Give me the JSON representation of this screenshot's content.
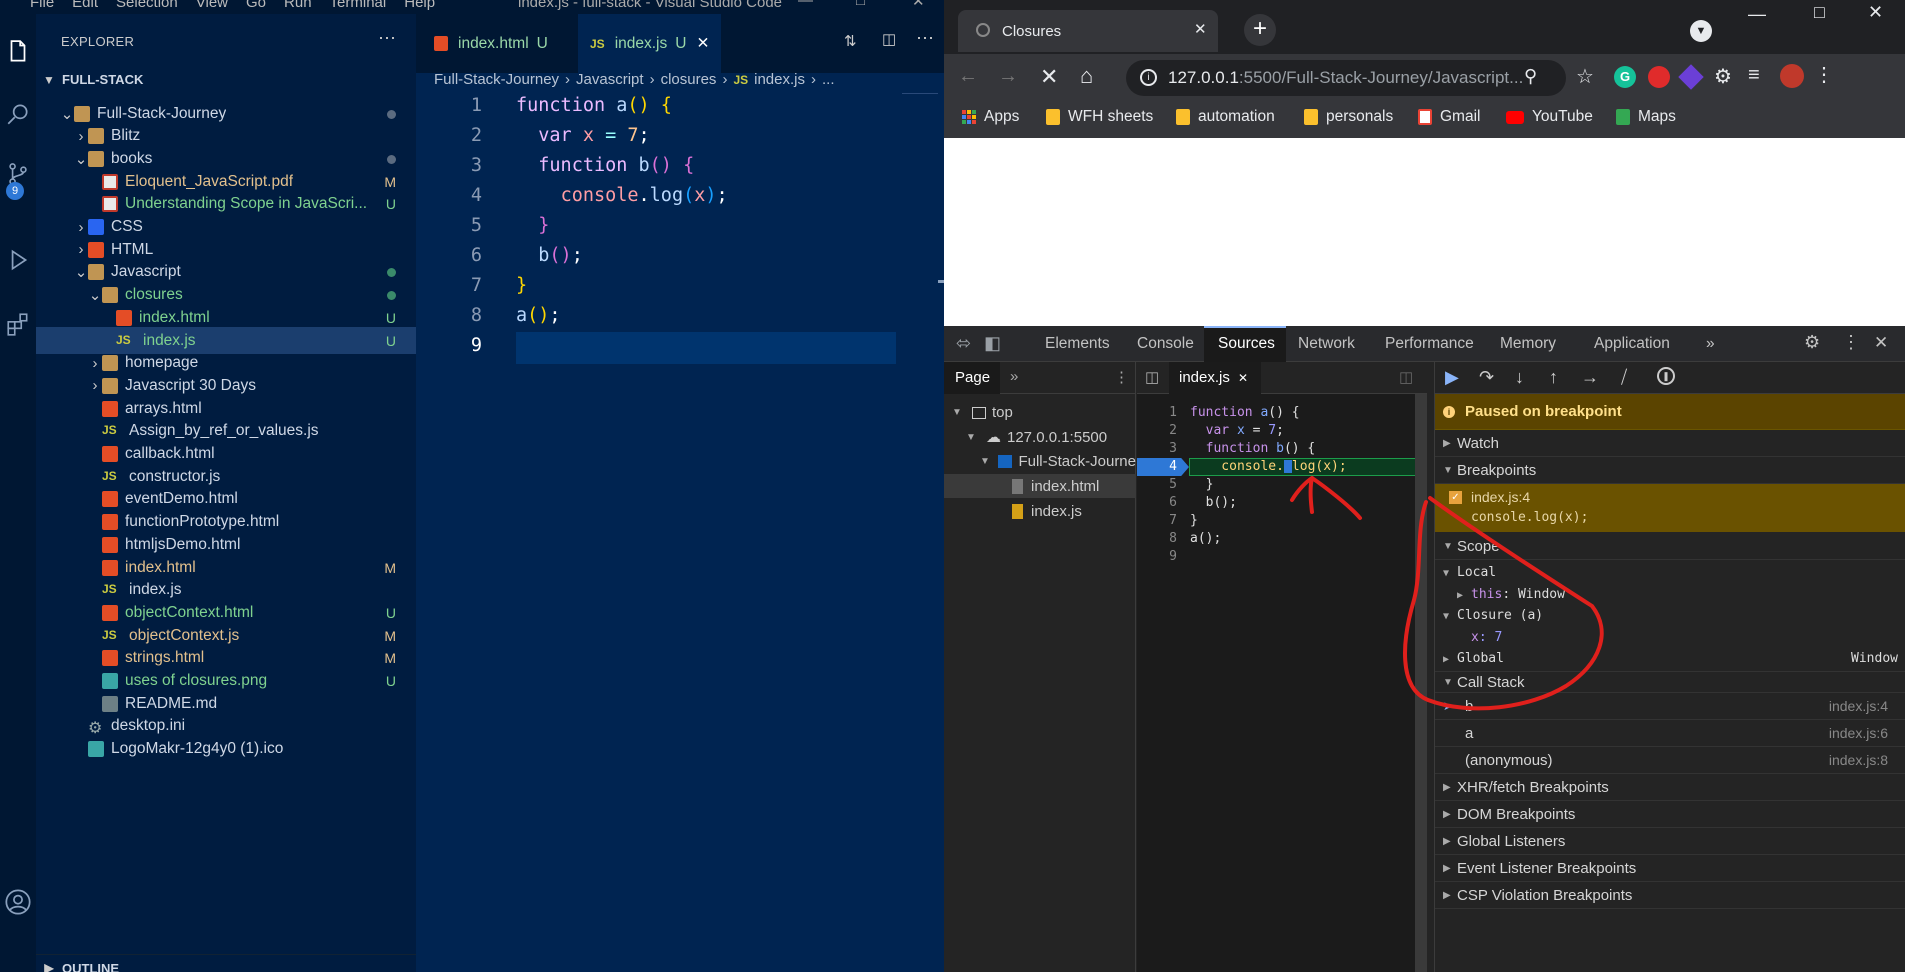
{
  "vscode": {
    "menu": [
      "File",
      "Edit",
      "Selection",
      "View",
      "Go",
      "Run",
      "Terminal",
      "Help"
    ],
    "window_title": "index.js - full-stack - Visual Studio Code",
    "scm_badge": "9",
    "explorer_title": "EXPLORER",
    "workspace": "FULL-STACK",
    "outline": "OUTLINE",
    "tree": [
      {
        "label": "Full-Stack-Journey",
        "type": "folder",
        "open": true,
        "status": "dot"
      },
      {
        "label": "Blitz",
        "type": "folder",
        "open": false,
        "status": ""
      },
      {
        "label": "books",
        "type": "folder",
        "open": true,
        "status": "dot"
      },
      {
        "label": "Eloquent_JavaScript.pdf",
        "type": "pdf",
        "status": "M"
      },
      {
        "label": "Understanding Scope in JavaScri...",
        "type": "pdf",
        "status": "U"
      },
      {
        "label": "CSS",
        "type": "css",
        "open": false,
        "status": ""
      },
      {
        "label": "HTML",
        "type": "html",
        "open": false,
        "status": ""
      },
      {
        "label": "Javascript",
        "type": "folder",
        "open": true,
        "status": "dotg"
      },
      {
        "label": "closures",
        "type": "folder",
        "open": true,
        "status": "dotg"
      },
      {
        "label": "index.html",
        "type": "html",
        "status": "U"
      },
      {
        "label": "index.js",
        "type": "js",
        "status": "U"
      },
      {
        "label": "homepage",
        "type": "folder",
        "open": false,
        "status": ""
      },
      {
        "label": "Javascript 30 Days",
        "type": "folder",
        "open": false,
        "status": ""
      },
      {
        "label": "arrays.html",
        "type": "html",
        "status": ""
      },
      {
        "label": "Assign_by_ref_or_values.js",
        "type": "js",
        "status": ""
      },
      {
        "label": "callback.html",
        "type": "html",
        "status": ""
      },
      {
        "label": "constructor.js",
        "type": "js",
        "status": ""
      },
      {
        "label": "eventDemo.html",
        "type": "html",
        "status": ""
      },
      {
        "label": "functionPrototype.html",
        "type": "html",
        "status": ""
      },
      {
        "label": "htmljsDemo.html",
        "type": "html",
        "status": ""
      },
      {
        "label": "index.html",
        "type": "html",
        "status": "M"
      },
      {
        "label": "index.js",
        "type": "js",
        "status": ""
      },
      {
        "label": "objectContext.html",
        "type": "html",
        "status": "U"
      },
      {
        "label": "objectContext.js",
        "type": "js",
        "status": "M"
      },
      {
        "label": "strings.html",
        "type": "html",
        "status": "M"
      },
      {
        "label": "uses of closures.png",
        "type": "img",
        "status": "U"
      },
      {
        "label": "README.md",
        "type": "md",
        "status": ""
      },
      {
        "label": "desktop.ini",
        "type": "gear",
        "status": ""
      },
      {
        "label": "LogoMakr-12g4y0 (1).ico",
        "type": "img",
        "status": ""
      }
    ],
    "tabs": [
      {
        "label": "index.html",
        "status": "U"
      },
      {
        "label": "index.js",
        "status": "U"
      }
    ],
    "breadcrumb": [
      "Full-Stack-Journey",
      "Javascript",
      "closures",
      "JS",
      "index.js",
      "..."
    ],
    "code_lines": [
      "1",
      "2",
      "3",
      "4",
      "5",
      "6",
      "7",
      "8",
      "9"
    ]
  },
  "chrome": {
    "tab_title": "Closures",
    "url_host": "127.0.0.1",
    "url_rest": ":5500/Full-Stack-Journey/Javascript...",
    "bookmarks": [
      "Apps",
      "WFH sheets",
      "automation",
      "personals",
      "Gmail",
      "YouTube",
      "Maps"
    ]
  },
  "devtools": {
    "tabs": [
      "Elements",
      "Console",
      "Sources",
      "Network",
      "Performance",
      "Memory",
      "Application"
    ],
    "nav_tab": "Page",
    "nav_tree": [
      "top",
      "127.0.0.1:5500",
      "Full-Stack-Journe",
      "index.html",
      "index.js"
    ],
    "file_tab": "index.js",
    "code": [
      "function a() {",
      "  var x = 7;",
      "  function b() {",
      "    console.log(x);",
      "  }",
      "  b();",
      "}",
      "a();",
      ""
    ],
    "paused": "Paused on breakpoint",
    "watch": "Watch",
    "breakpoints": "Breakpoints",
    "bp_file": "index.js:4",
    "bp_code": "console.log(x);",
    "scope": "Scope",
    "local": "Local",
    "this_key": "this",
    "this_val": ": Window",
    "closure": "Closure (a)",
    "x_key": "x",
    "x_val": ": 7",
    "global": "Global",
    "global_val": "Window",
    "call_stack": "Call Stack",
    "frames": [
      {
        "fn": "b",
        "loc": "index.js:4"
      },
      {
        "fn": "a",
        "loc": "index.js:6"
      },
      {
        "fn": "(anonymous)",
        "loc": "index.js:8"
      }
    ],
    "sections": [
      "XHR/fetch Breakpoints",
      "DOM Breakpoints",
      "Global Listeners",
      "Event Listener Breakpoints",
      "CSP Violation Breakpoints"
    ]
  },
  "colors": {
    "annotation": "#e0201c",
    "accent": "#8ab4f8"
  }
}
